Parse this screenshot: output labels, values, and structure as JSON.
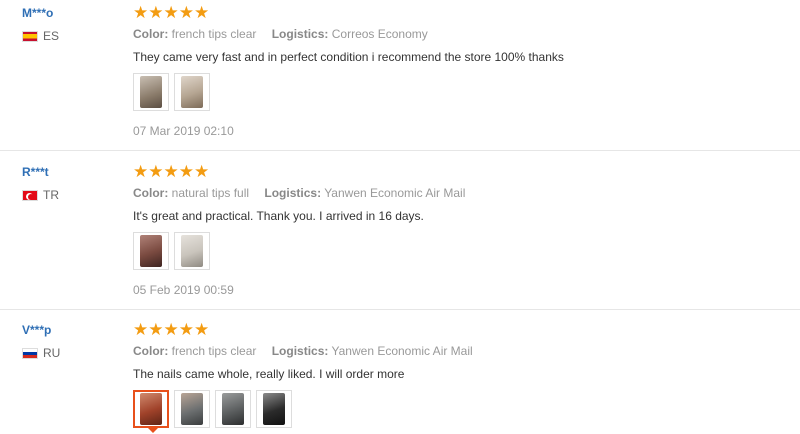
{
  "reviews": [
    {
      "user": "M***o",
      "country": "ES",
      "flag": "spain-flag-icon",
      "rating": "★★★★★",
      "color_label": "Color:",
      "color_value": "french tips clear",
      "logistics_label": "Logistics:",
      "logistics_value": "Correos Economy",
      "text": "They came very fast and in perfect condition i recommend the store 100% thanks",
      "date": "07 Mar 2019 02:10",
      "photos": [
        {
          "tone": "#8a7b6a"
        },
        {
          "tone": "#b5a592"
        }
      ]
    },
    {
      "user": "R***t",
      "country": "TR",
      "flag": "turkey-flag-icon",
      "rating": "★★★★★",
      "color_label": "Color:",
      "color_value": "natural tips full",
      "logistics_label": "Logistics:",
      "logistics_value": "Yanwen Economic Air Mail",
      "text": "It's great and practical. Thank you. I arrived in 16 days.",
      "date": "05 Feb 2019 00:59",
      "photos": [
        {
          "tone": "#7a4a40"
        },
        {
          "tone": "#c9c4bc"
        }
      ]
    },
    {
      "user": "V***p",
      "country": "RU",
      "flag": "russia-flag-icon",
      "rating": "★★★★★",
      "color_label": "Color:",
      "color_value": "french tips clear",
      "logistics_label": "Logistics:",
      "logistics_value": "Yanwen Economic Air Mail",
      "text": "The nails came whole, really liked. I will order more",
      "date": "",
      "photos": [
        {
          "tone": "#a0422a"
        },
        {
          "tone": "#6c6f70"
        },
        {
          "tone": "#5c5f60"
        },
        {
          "tone": "#2b2b2b"
        }
      ]
    }
  ]
}
